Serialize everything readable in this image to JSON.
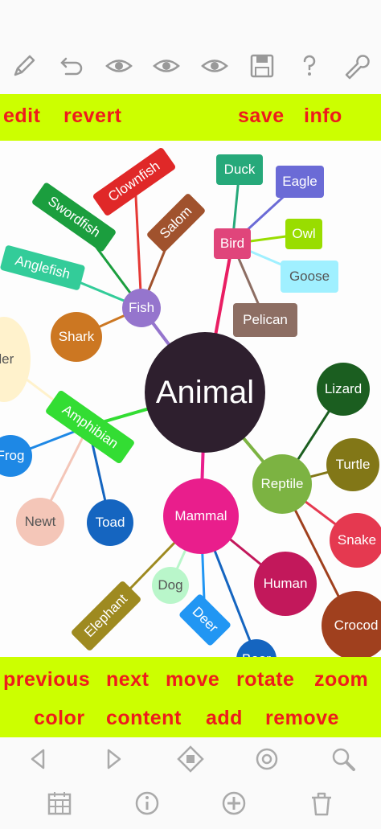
{
  "toolbar_top": {
    "icons": [
      "pencil-icon",
      "undo-icon",
      "eye-icon",
      "eye-icon",
      "eye-icon",
      "save-disk-icon",
      "help-icon",
      "wrench-icon"
    ]
  },
  "top_commands": {
    "edit": "edit",
    "revert": "revert",
    "save": "save",
    "info": "info"
  },
  "mindmap": {
    "root": "Animal",
    "fish": "Fish",
    "bird": "Bird",
    "amphibian": "Amphibian",
    "reptile": "Reptile",
    "mammal": "Mammal",
    "clownfish": "Clownfish",
    "swordfish": "Swordfish",
    "salom": "Salom",
    "anglefish": "Anglefish",
    "shark": "Shark",
    "duck": "Duck",
    "eagle": "Eagle",
    "owl": "Owl",
    "goose": "Goose",
    "pelican": "Pelican",
    "spider": "der",
    "frog": "Frog",
    "newt": "Newt",
    "toad": "Toad",
    "lizard": "Lizard",
    "turtle": "Turtle",
    "snake": "Snake",
    "crocodile": "Crocod",
    "human": "Human",
    "dog": "Dog",
    "deer": "Deer",
    "elephant": "Elephant",
    "bear": "Bear"
  },
  "bottom_commands": {
    "previous": "previous",
    "next": "next",
    "move": "move",
    "rotate": "rotate",
    "zoom": "zoom",
    "color": "color",
    "content": "content",
    "add": "add",
    "remove": "remove"
  },
  "bottom_icons_row1": [
    "prev-arrow-icon",
    "next-arrow-icon",
    "move-icon",
    "rotate-icon",
    "zoom-icon"
  ],
  "bottom_icons_row2": [
    "calendar-icon",
    "info-icon",
    "add-icon",
    "trash-icon"
  ],
  "colors": {
    "command_bar": "#ccff00",
    "command_text": "#ee1c1c",
    "root": "#2e1f2e"
  }
}
